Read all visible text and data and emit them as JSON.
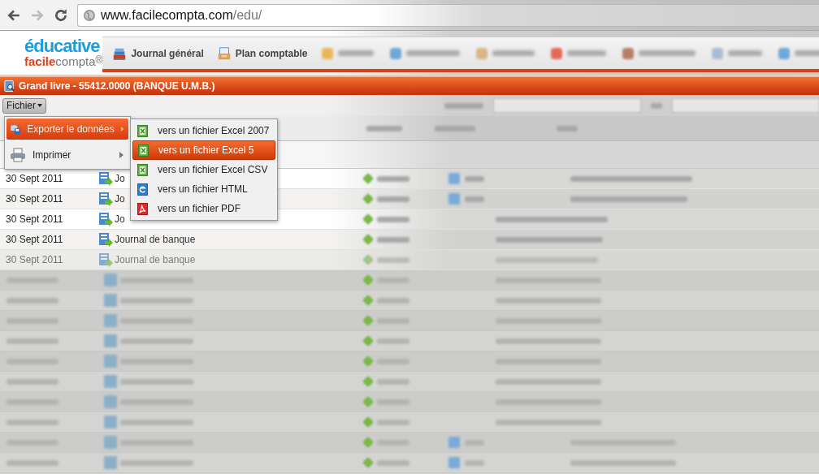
{
  "browser": {
    "url_host": "www.facilecompta.com",
    "url_path": "/edu/"
  },
  "logo": {
    "line1": "éducative",
    "line2_strong": "facile",
    "line2": "compta",
    "mark": "®"
  },
  "tabs": [
    {
      "label": "Journal général",
      "kind": "books",
      "selected": false
    },
    {
      "label": "Plan comptable",
      "kind": "tray",
      "selected": false
    }
  ],
  "title": "Grand livre - 55412.0000 (BANQUE U.M.B.)",
  "menu_button": "Fichier",
  "file_menu": [
    {
      "label": "Exporter le données",
      "kind": "export",
      "selected": true,
      "has_submenu": true
    },
    {
      "label": "Imprimer",
      "kind": "print",
      "selected": false,
      "has_submenu": true
    }
  ],
  "export_submenu": [
    {
      "label": "vers un fichier Excel 2007",
      "kind": "excel",
      "selected": false
    },
    {
      "label": "vers un fichier Excel 5",
      "kind": "excel",
      "selected": true
    },
    {
      "label": "vers un fichier Excel CSV",
      "kind": "excel",
      "selected": false
    },
    {
      "label": "vers un fichier HTML",
      "kind": "html",
      "selected": false
    },
    {
      "label": "vers un fichier PDF",
      "kind": "pdf",
      "selected": false
    }
  ],
  "rows": [
    {
      "date": "30 Sept 2011",
      "journal": "Jo",
      "faded": false
    },
    {
      "date": "30 Sept 2011",
      "journal": "Jo",
      "faded": false
    },
    {
      "date": "30 Sept 2011",
      "journal": "Jo",
      "faded": false
    },
    {
      "date": "30 Sept 2011",
      "journal": "Journal de banque",
      "faded": false
    },
    {
      "date": "30 Sept 2011",
      "journal": "Journal de banque",
      "faded": true
    }
  ]
}
